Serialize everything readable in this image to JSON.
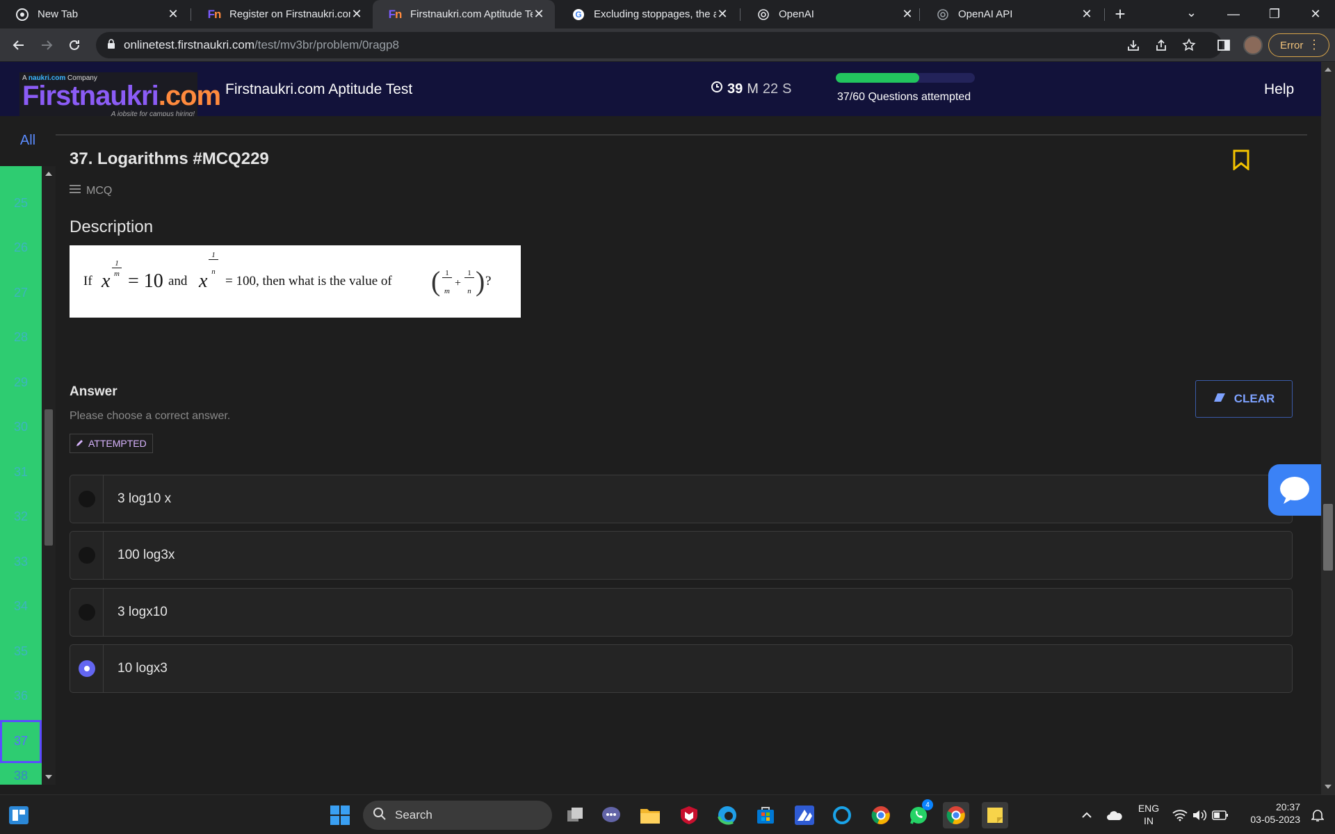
{
  "browser": {
    "tabs": [
      {
        "title": "New Tab",
        "favicon": "chrome-icon"
      },
      {
        "title": "Register on Firstnaukri.com",
        "favicon": "firstnaukri-icon"
      },
      {
        "title": "Firstnaukri.com Aptitude Te",
        "favicon": "firstnaukri-icon",
        "active": true
      },
      {
        "title": "Excluding stoppages, the av",
        "favicon": "google-icon"
      },
      {
        "title": "OpenAI",
        "favicon": "openai-icon"
      },
      {
        "title": "OpenAI API",
        "favicon": "openai-icon"
      }
    ],
    "url_host": "onlinetest.firstnaukri.com",
    "url_path": "/test/mv3br/problem/0ragp8",
    "error_label": "Error"
  },
  "header": {
    "logo_tagline_prefix": "A",
    "logo_tagline_brand": "naukri.com",
    "logo_tagline_suffix": "Company",
    "logo_first": "Firstnaukri",
    "logo_dot": ".com",
    "logo_sub": "A jobsite for campus hiring!",
    "title": "Firstnaukri.com Aptitude Test",
    "timer_minutes": "39",
    "timer_minutes_unit": "M",
    "timer_seconds": "22",
    "timer_seconds_unit": "S",
    "progress_fraction": 0.6,
    "attempted_text": "37/60 Questions attempted",
    "help_label": "Help"
  },
  "nav": {
    "all_label": "All",
    "numbers": [
      "24",
      "25",
      "26",
      "27",
      "28",
      "29",
      "30",
      "31",
      "32",
      "33",
      "34",
      "35",
      "36",
      "37",
      "38"
    ],
    "current": "37"
  },
  "question": {
    "title": "37. Logarithms #MCQ229",
    "type": "MCQ",
    "description_heading": "Description",
    "statement": {
      "if": "If",
      "x": "x",
      "exp1_num": "1",
      "exp1_den": "m",
      "eq1": "= 10",
      "and": "and",
      "exp2_num": "1",
      "exp2_den": "n",
      "eq2": "= 100, then what is the value of",
      "frac_num": "1",
      "frac_den1": "m",
      "frac_den2": "n",
      "plus": "+",
      "qmark": "?"
    },
    "answer_heading": "Answer",
    "answer_hint": "Please choose a correct answer.",
    "status_badge": "ATTEMPTED",
    "clear_label": "CLEAR",
    "options": [
      {
        "label": "3 log10 x",
        "selected": false
      },
      {
        "label": "100 log3x",
        "selected": false
      },
      {
        "label": "3 logx10",
        "selected": false
      },
      {
        "label": "10 logx3",
        "selected": true
      }
    ]
  },
  "taskbar": {
    "search_label": "Search",
    "lang_line1": "ENG",
    "lang_line2": "IN",
    "time": "20:37",
    "date": "03-05-2023",
    "whatsapp_badge": "4"
  },
  "colors": {
    "progress": "#22c55e",
    "nav_attempted": "#2ecc71",
    "accent": "#6366f1",
    "header_bg": "#12123a"
  }
}
